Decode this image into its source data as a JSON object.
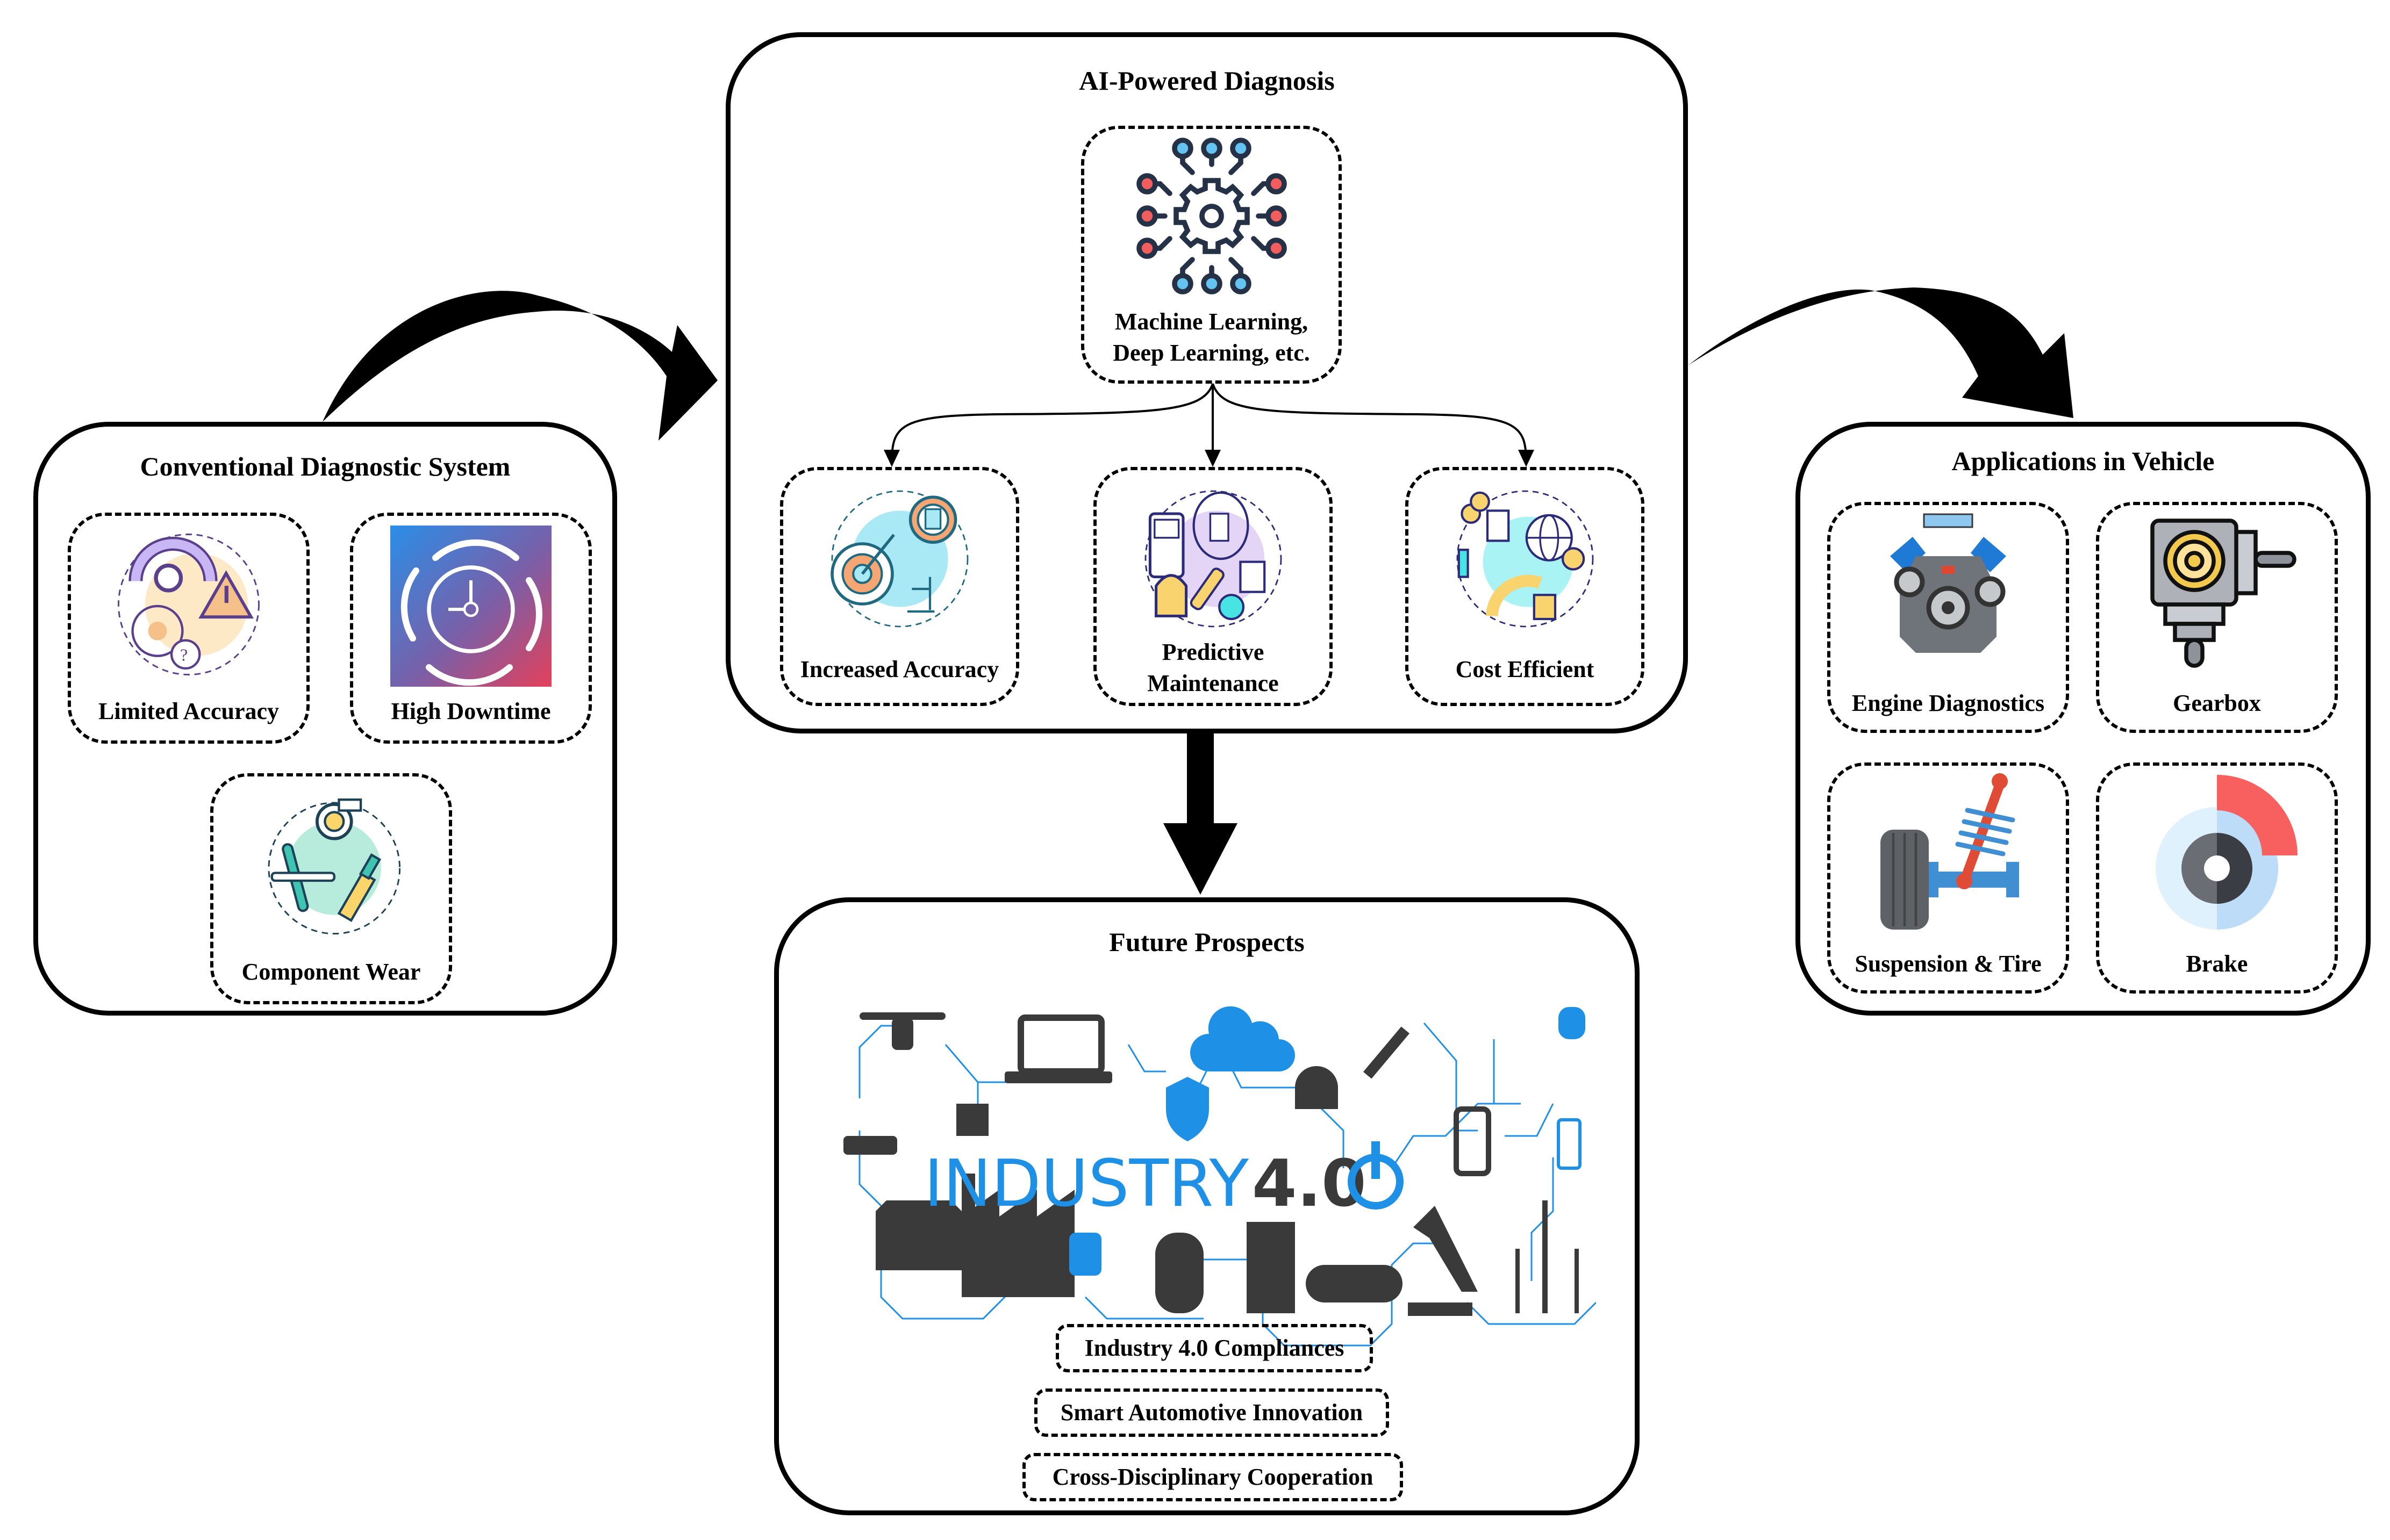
{
  "conventional": {
    "title": "Conventional Diagnostic System",
    "items": [
      {
        "label": "Limited Accuracy",
        "icon": "limited-accuracy-icon"
      },
      {
        "label": "High Downtime",
        "icon": "downtime-clock-icon"
      },
      {
        "label": "Component Wear",
        "icon": "component-wear-icon"
      }
    ]
  },
  "ai": {
    "title": "AI-Powered Diagnosis",
    "core": {
      "label_line1": "Machine Learning,",
      "label_line2": "Deep Learning, etc.",
      "icon": "neural-gear-icon"
    },
    "benefits": [
      {
        "label": "Increased Accuracy",
        "icon": "target-accuracy-icon"
      },
      {
        "label_line1": "Predictive",
        "label_line2": "Maintenance",
        "icon": "predictive-maintenance-icon"
      },
      {
        "label": "Cost Efficient",
        "icon": "cost-efficient-icon"
      }
    ]
  },
  "future": {
    "title": "Future Prospects",
    "graphic": {
      "word": "INDUSTRY",
      "version": "4.0",
      "icon": "industry-4-0-network-icon"
    },
    "items": [
      "Industry 4.0 Compliances",
      "Smart Automotive Innovation",
      "Cross-Disciplinary Cooperation"
    ]
  },
  "applications": {
    "title": "Applications in Vehicle",
    "items": [
      {
        "label": "Engine Diagnostics",
        "icon": "engine-icon"
      },
      {
        "label": "Gearbox",
        "icon": "gearbox-icon"
      },
      {
        "label": "Suspension & Tire",
        "icon": "suspension-tire-icon"
      },
      {
        "label": "Brake",
        "icon": "brake-disc-icon"
      }
    ]
  },
  "colors": {
    "stroke": "#000000",
    "accent_blue": "#1e90e6",
    "dark_gray": "#3a3a3a",
    "red": "#f25d5d",
    "light_blue": "#64c3f0"
  }
}
